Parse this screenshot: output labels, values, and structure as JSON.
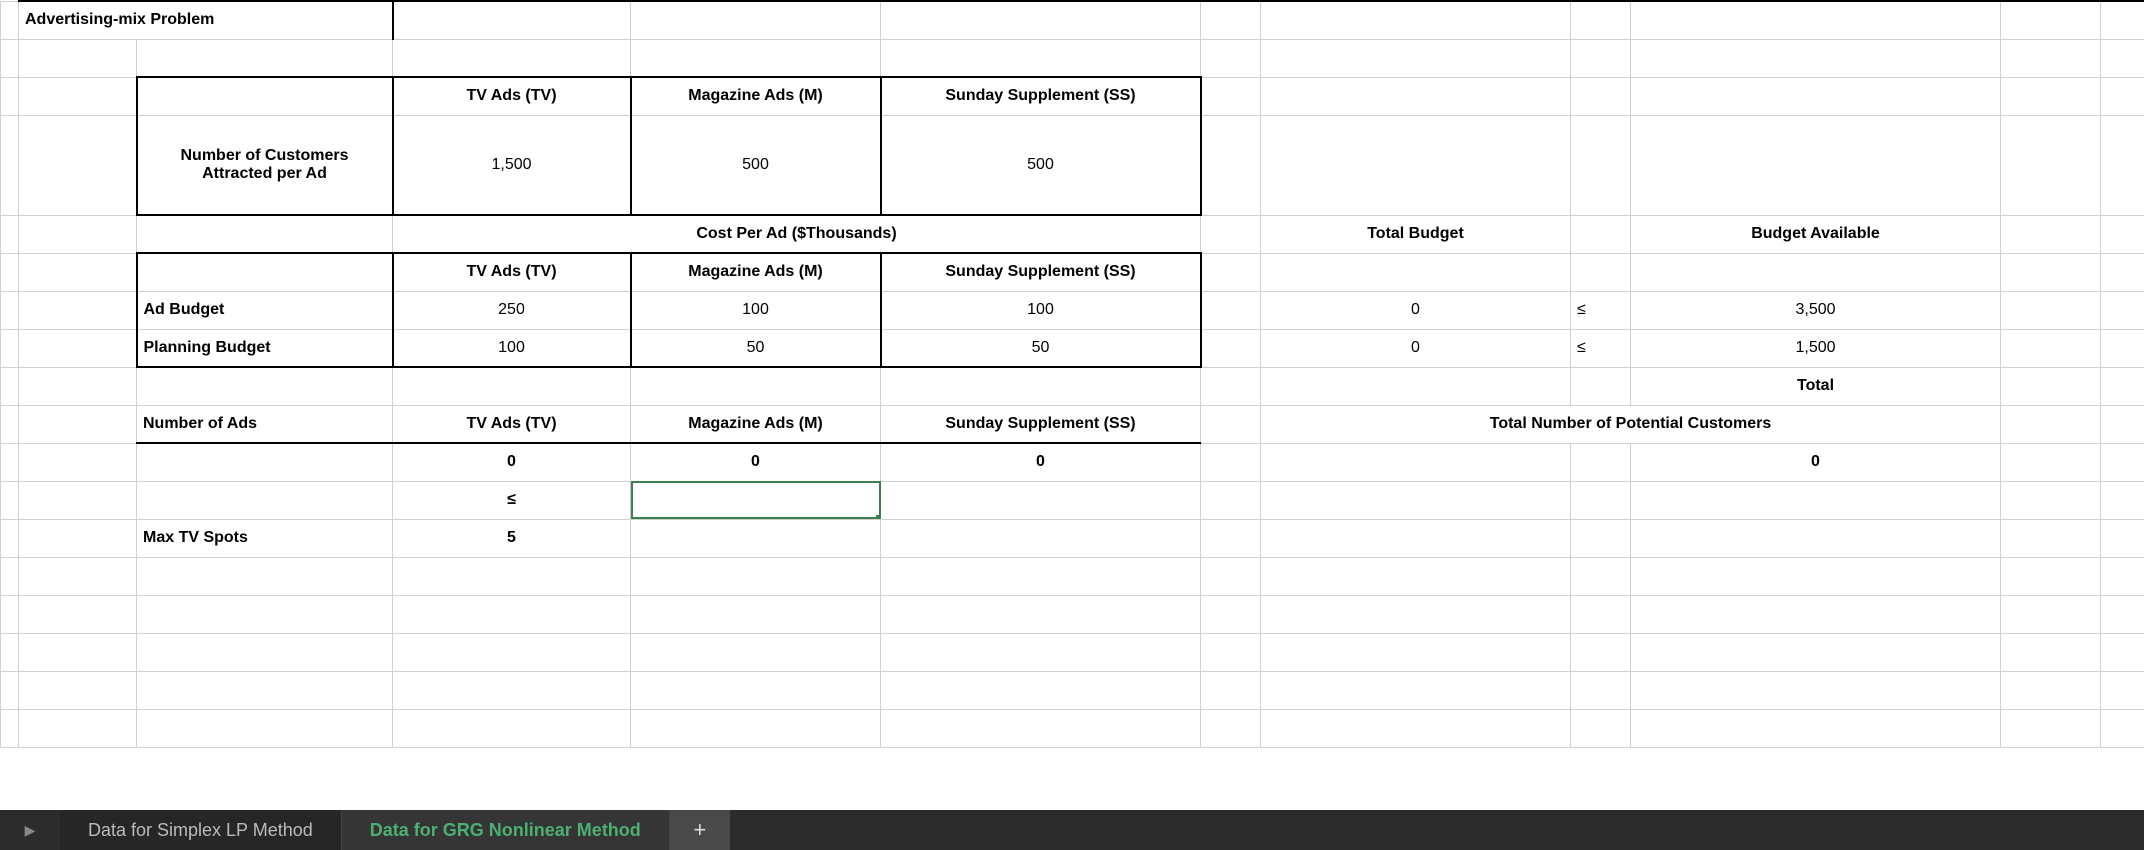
{
  "title": "Advertising-mix Problem",
  "col_headers": {
    "tv": "TV Ads (TV)",
    "mag": "Magazine Ads (M)",
    "ss": "Sunday Supplement (SS)"
  },
  "customers_row": {
    "label": "Number of Customers Attracted per Ad",
    "tv": "1,500",
    "mag": "500",
    "ss": "500"
  },
  "cost_header": "Cost Per Ad ($Thousands)",
  "budget_labels": {
    "total": "Total Budget",
    "avail": "Budget Available"
  },
  "ad_budget": {
    "label": "Ad Budget",
    "tv": "250",
    "mag": "100",
    "ss": "100",
    "total": "0",
    "op": "≤",
    "avail": "3,500"
  },
  "plan_budget": {
    "label": "Planning Budget",
    "tv": "100",
    "mag": "50",
    "ss": "50",
    "total": "0",
    "op": "≤",
    "avail": "1,500"
  },
  "total_label": "Total",
  "number_of_ads": {
    "label": "Number of Ads",
    "tv": "0",
    "mag": "0",
    "ss": "0"
  },
  "potential_label": "Total Number of Potential Customers",
  "potential_value": "0",
  "tv_constraint": {
    "op": "≤",
    "label": "Max TV Spots",
    "value": "5"
  },
  "tabs": {
    "inactive": "Data for Simplex LP Method",
    "active": "Data for GRG Nonlinear Method",
    "plus": "+"
  }
}
